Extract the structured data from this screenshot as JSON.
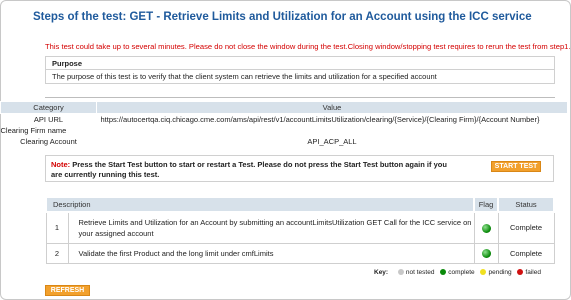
{
  "page": {
    "title": "Steps of the test: GET - Retrieve Limits and Utilization for an Account using the ICC service",
    "warning": "This test could take up to several minutes. Please do not close the window during the test.Closing window/stopping test requires to rerun the test from step1."
  },
  "purpose": {
    "header": "Purpose",
    "text": "The purpose of this test is to verify that the client system can retrieve the limits and utilization for a specified account"
  },
  "info_table": {
    "headers": {
      "category": "Category",
      "value": "Value"
    },
    "rows": [
      {
        "category": "API URL",
        "value": "https://autocertqa.ciq.chicago.cme.com/ams/api/rest/v1/accountLimitsUtilization/clearing/{Service}/{Clearing Firm}/{Account Number}"
      },
      {
        "category": "Clearing Firm name",
        "value": ""
      },
      {
        "category": "Clearing Account",
        "value": "API_ACP_ALL"
      }
    ]
  },
  "note": {
    "label": "Note:",
    "text": " Press the Start Test button to start or restart a Test. Please do not press the Start Test button again if you are currently running this test.",
    "start_button": "START TEST"
  },
  "steps_table": {
    "headers": {
      "description": "Description",
      "flag": "Flag",
      "status": "Status"
    },
    "rows": [
      {
        "num": "1",
        "description": "Retrieve Limits and Utilization for an Account by submitting an accountLimitsUtilization GET Call for the ICC service on your assigned account",
        "flag": "green",
        "status": "Complete"
      },
      {
        "num": "2",
        "description": "Validate the first Product and the long limit under cmfLimits",
        "flag": "green",
        "status": "Complete"
      }
    ]
  },
  "key": {
    "label": "Key:",
    "items": [
      {
        "label": "not tested",
        "color": "#c8c8c8"
      },
      {
        "label": "complete",
        "color": "#0a8a0a"
      },
      {
        "label": "pending",
        "color": "#f0e020"
      },
      {
        "label": "failed",
        "color": "#d01010"
      }
    ]
  },
  "refresh_button": "REFRESH",
  "colors": {
    "title": "#1f5a9c",
    "warning": "#d40000",
    "button": "#f2a02c",
    "table_header": "#d7e1ea"
  }
}
